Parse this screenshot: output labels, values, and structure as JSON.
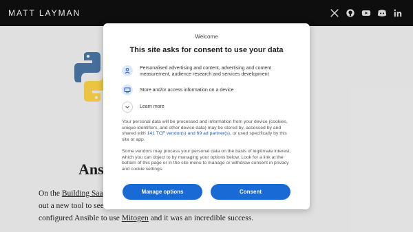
{
  "header": {
    "site_title": "MATT LAYMAN",
    "social_icons": [
      "x-icon",
      "github-icon",
      "youtube-icon",
      "discord-icon",
      "linkedin-icon"
    ]
  },
  "article": {
    "heading_partial": "Ansi",
    "para1_start": "On the ",
    "para1_link": "Building Saa",
    "para2": "out a new tool to see",
    "para3_start": "configured Ansible to use ",
    "para3_link": "Mitogen",
    "para3_end": " and it was an incredible success."
  },
  "consent": {
    "welcome": "Welcome",
    "title": "This site asks for consent to use your data",
    "purposes": [
      {
        "icon": "person-icon",
        "text": "Personalised advertising and content, advertising and content measurement, audience research and services development"
      },
      {
        "icon": "device-icon",
        "text": "Store and/or access information on a device"
      }
    ],
    "learn_more": "Learn more",
    "para1_a": "Your personal data will be processed and information from your device (cookies, unique identifiers, and other device data) may be stored by, accessed by and shared with ",
    "para1_link": "141 TCF vendor(s) and 69 ad partner(s)",
    "para1_b": ", or used specifically by this site or app.",
    "para2": "Some vendors may process your personal data on the basis of legitimate interest, which you can object to by managing your options below. Look for a link at the bottom of this page or in the site menu to manage or withdraw consent in privacy and cookie settings.",
    "manage_button": "Manage options",
    "consent_button": "Consent"
  },
  "colors": {
    "header_bg": "#101010",
    "accent": "#1a6ad6",
    "link": "#1a5cc9"
  }
}
